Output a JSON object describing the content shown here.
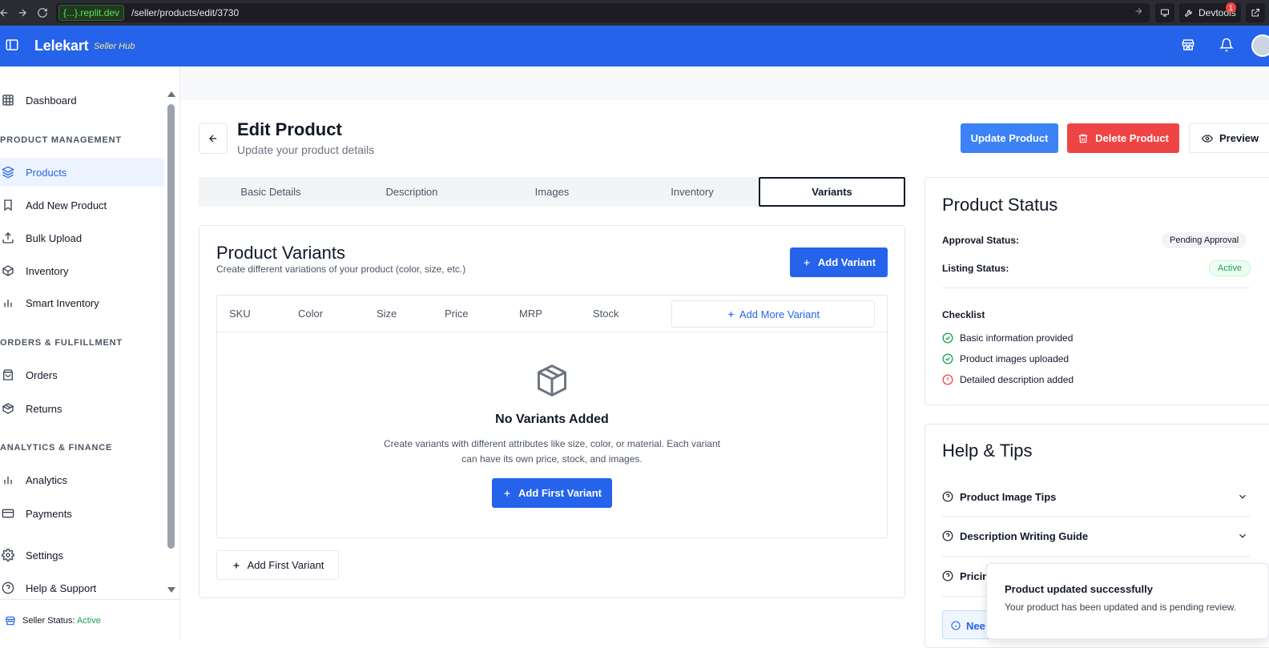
{
  "browser": {
    "domain": "{...}.replit.dev",
    "path": "/seller/products/edit/3730",
    "devtools_label": "Devtools",
    "devtools_badge": "1"
  },
  "header": {
    "brand": "Lelekart",
    "brand_sub": "Seller Hub",
    "color": "#2563eb"
  },
  "sidebar": {
    "items": [
      {
        "label": "Dashboard",
        "icon": "grid-icon"
      },
      {
        "label": "Products",
        "icon": "layers-icon",
        "active": true
      },
      {
        "label": "Add New Product",
        "icon": "bookmark-icon"
      },
      {
        "label": "Bulk Upload",
        "icon": "upload-icon"
      },
      {
        "label": "Inventory",
        "icon": "box-icon"
      },
      {
        "label": "Smart Inventory",
        "icon": "bar-chart-icon"
      },
      {
        "label": "Orders",
        "icon": "shopping-bag-icon"
      },
      {
        "label": "Returns",
        "icon": "package-icon"
      },
      {
        "label": "Analytics",
        "icon": "bar-chart-icon"
      },
      {
        "label": "Payments",
        "icon": "credit-card-icon"
      },
      {
        "label": "Settings",
        "icon": "gear-icon"
      },
      {
        "label": "Help & Support",
        "icon": "help-circle-icon"
      }
    ],
    "sections": [
      "PRODUCT MANAGEMENT",
      "ORDERS & FULFILLMENT",
      "ANALYTICS & FINANCE"
    ],
    "seller_status_label": "Seller Status:",
    "seller_status_value": "Active"
  },
  "page": {
    "title": "Edit Product",
    "subtitle": "Update your product details",
    "update_button": "Update Product",
    "delete_button": "Delete Product",
    "preview_button": "Preview"
  },
  "tabs": [
    "Basic Details",
    "Description",
    "Images",
    "Inventory",
    "Variants"
  ],
  "active_tab": "Variants",
  "variants": {
    "title": "Product Variants",
    "subtitle": "Create different variations of your product (color, size, etc.)",
    "add_variant_button": "Add Variant",
    "columns": [
      "SKU",
      "Color",
      "Size",
      "Price",
      "MRP",
      "Stock"
    ],
    "add_more_button": "Add More Variant",
    "empty_title": "No Variants Added",
    "empty_desc": "Create variants with different attributes like size, color, or material. Each variant can have its own price, stock, and images.",
    "add_first_button": "Add First Variant",
    "add_first_outline_button": "Add First Variant"
  },
  "status_panel": {
    "title": "Product Status",
    "approval_label": "Approval Status:",
    "approval_value": "Pending Approval",
    "listing_label": "Listing Status:",
    "listing_value": "Active",
    "checklist_title": "Checklist",
    "checklist": [
      {
        "label": "Basic information provided",
        "done": true
      },
      {
        "label": "Product images uploaded",
        "done": true
      },
      {
        "label": "Detailed description added",
        "done": false
      }
    ]
  },
  "help_panel": {
    "title": "Help & Tips",
    "items": [
      "Product Image Tips",
      "Description Writing Guide",
      "Pricin"
    ],
    "info_text": "Nee"
  },
  "toast": {
    "title": "Product updated successfully",
    "message": "Your product has been updated and is pending review."
  }
}
